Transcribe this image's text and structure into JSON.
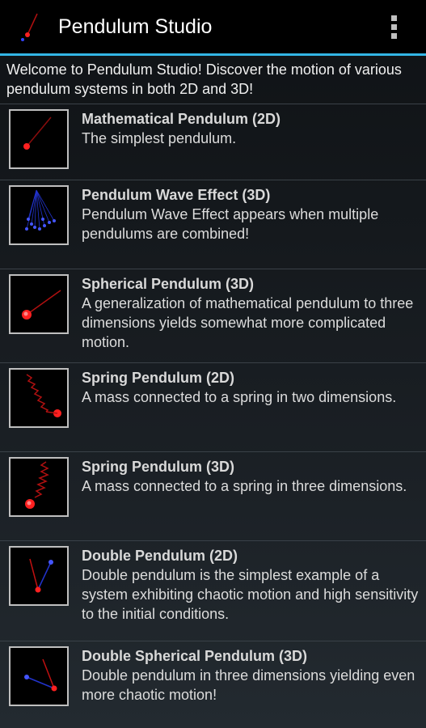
{
  "app": {
    "title": "Pendulum Studio"
  },
  "intro": "Welcome to Pendulum Studio! Discover the motion of various pendulum systems in both 2D and 3D!",
  "items": [
    {
      "title": "Mathematical Pendulum (2D)",
      "desc": "The simplest pendulum."
    },
    {
      "title": "Pendulum Wave Effect (3D)",
      "desc": "Pendulum Wave Effect appears when multiple pendulums are combined!"
    },
    {
      "title": "Spherical Pendulum (3D)",
      "desc": "A generalization of mathematical pendulum to three dimensions yields somewhat more complicated motion."
    },
    {
      "title": "Spring Pendulum (2D)",
      "desc": "A mass connected to a spring in two dimensions."
    },
    {
      "title": "Spring Pendulum (3D)",
      "desc": "A mass connected to a spring in three dimensions."
    },
    {
      "title": "Double Pendulum (2D)",
      "desc": "Double pendulum is the simplest example of a system exhibiting chaotic motion and high sensitivity to the initial conditions."
    },
    {
      "title": "Double Spherical Pendulum (3D)",
      "desc": "Double pendulum in three dimensions yielding even more chaotic motion!"
    }
  ],
  "colors": {
    "accent": "#33b5e5",
    "mass": "#ff2020",
    "rod": "#c01010",
    "blue": "#3344ff"
  }
}
